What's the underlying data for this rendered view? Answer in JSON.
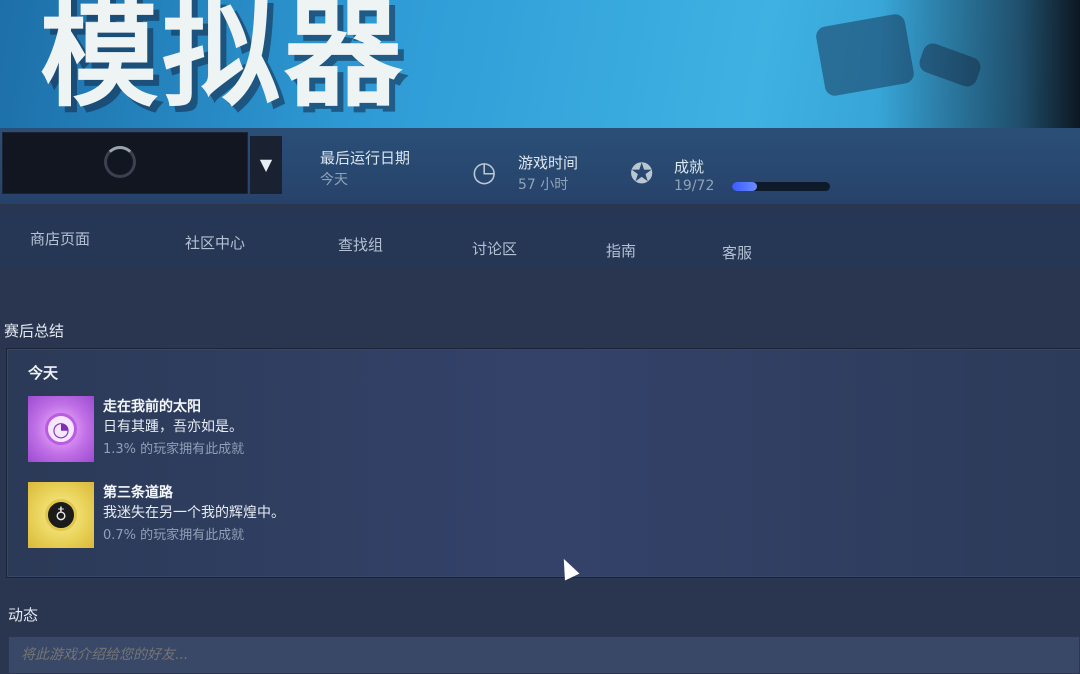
{
  "hero": {
    "title": "模拟器"
  },
  "stats": {
    "last_run_label": "最后运行日期",
    "last_run_value": "今天",
    "playtime_label": "游戏时间",
    "playtime_value": "57 小时",
    "achievements_label": "成就",
    "achievements_value": "19/72",
    "achievements_progress": 0.26
  },
  "nav": {
    "items": [
      "商店页面",
      "社区中心",
      "查找组",
      "讨论区",
      "指南",
      "客服"
    ]
  },
  "summary": {
    "title": "赛后总结",
    "day": "今天",
    "achievements": [
      {
        "name": "走在我前的太阳",
        "desc": "日有其踵，吾亦如是。",
        "pct": "1.3% 的玩家拥有此成就",
        "icon": "sun-achievement-icon"
      },
      {
        "name": "第三条道路",
        "desc": "我迷失在另一个我的辉煌中。",
        "pct": "0.7% 的玩家拥有此成就",
        "icon": "path-achievement-icon"
      }
    ]
  },
  "activity": {
    "title": "动态",
    "placeholder": "将此游戏介绍给您的好友..."
  },
  "colors": {
    "accent_progress": "#3b5cff",
    "purple_badge": "#c06fe6",
    "gold_badge": "#e9d35a"
  }
}
